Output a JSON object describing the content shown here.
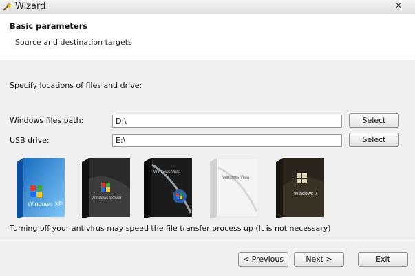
{
  "window": {
    "title": "Wizard",
    "close_glyph": "×"
  },
  "header": {
    "title": "Basic parameters",
    "subtitle": "Source and destination targets"
  },
  "main": {
    "instruction": "Specify locations of files and drive:",
    "windows_path": {
      "label": "Windows files path:",
      "value": "D:\\",
      "button": "Select"
    },
    "usb_drive": {
      "label": "USB drive:",
      "value": "E:\\",
      "button": "Select"
    },
    "boxes": [
      {
        "name": "windows-xp-box",
        "text": "Windows XP"
      },
      {
        "name": "windows-server-box",
        "text": "Windows Server"
      },
      {
        "name": "windows-vista-box",
        "text": "Windows Vista"
      },
      {
        "name": "windows-vista-home-box",
        "text": "Windows Vista"
      },
      {
        "name": "windows-7-box",
        "text": "Windows 7"
      }
    ],
    "note": "Turning off your antivirus may speed the file transfer process up (It is not necessary)"
  },
  "footer": {
    "previous": "< Previous",
    "next": "Next >",
    "exit": "Exit"
  }
}
